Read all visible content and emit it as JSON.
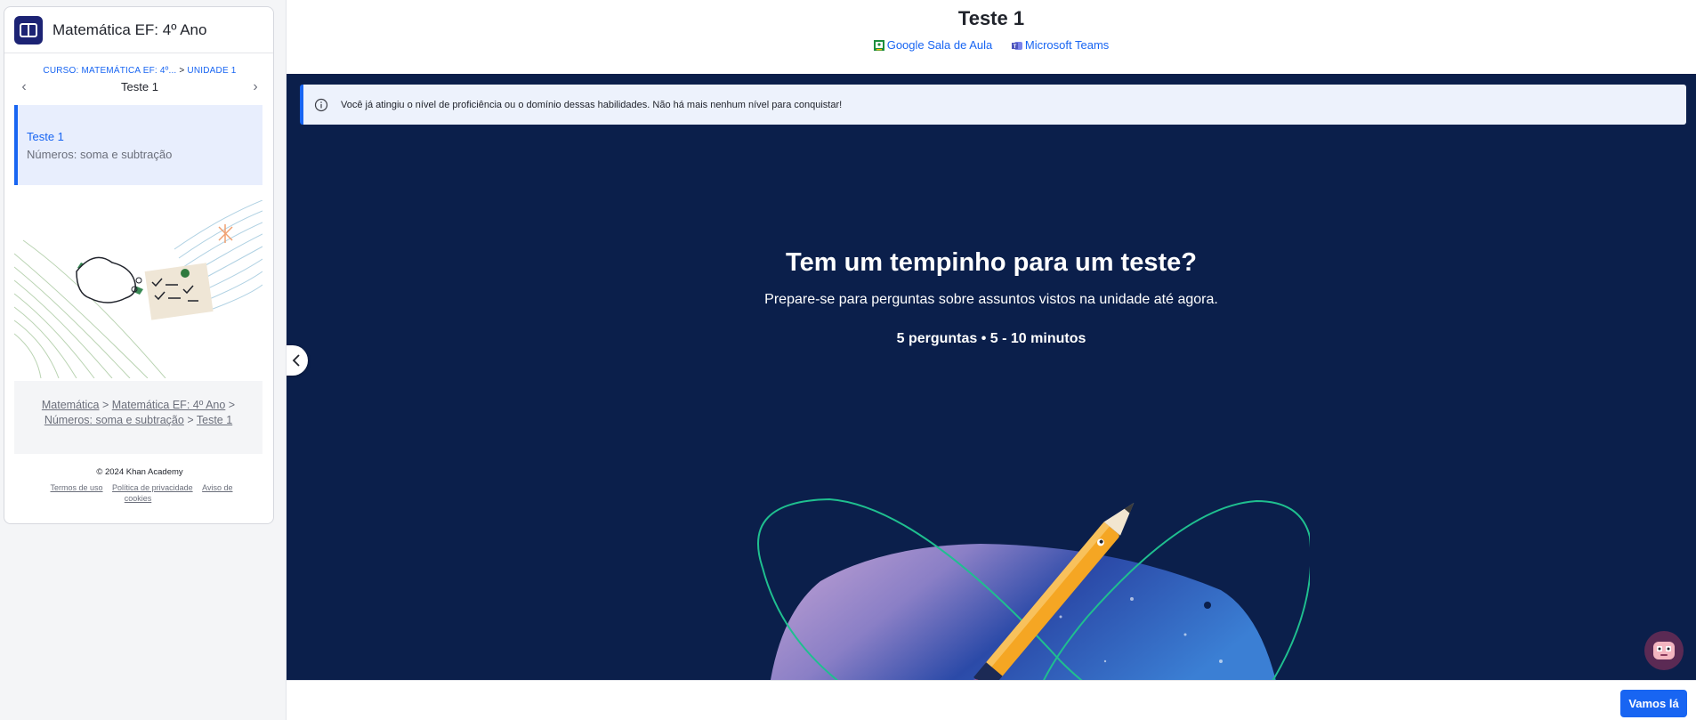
{
  "sidebar": {
    "course_title": "Matemática EF: 4º Ano",
    "breadcrumb_small": {
      "course": "CURSO: MATEMÁTICA EF: 4º...",
      "separator": ">",
      "unit": "UNIDADE 1"
    },
    "nav_title": "Teste 1",
    "active_item": {
      "title": "Teste 1",
      "subtitle": "Números: soma e subtração"
    },
    "breadcrumb": {
      "items": [
        "Matemática",
        "Matemática EF: 4º Ano",
        "Números: soma e subtração",
        "Teste 1"
      ],
      "separator": ">"
    },
    "footer": {
      "copyright": "© 2024 Khan Academy",
      "links": [
        "Termos de uso",
        "Política de privacidade",
        "Aviso de cookies"
      ]
    }
  },
  "header": {
    "title": "Teste 1",
    "share": [
      {
        "label": "Google Sala de Aula",
        "icon": "google-classroom-icon"
      },
      {
        "label": "Microsoft Teams",
        "icon": "microsoft-teams-icon"
      }
    ]
  },
  "notice": {
    "text": "Você já atingiu o nível de proficiência ou o domínio dessas habilidades. Não há mais nenhum nível para conquistar!",
    "icon": "info-icon"
  },
  "quiz": {
    "title": "Tem um tempinho para um teste?",
    "subtitle": "Prepare-se para perguntas sobre assuntos vistos na unidade até agora.",
    "meta": "5 perguntas • 5 - 10 minutos"
  },
  "actions": {
    "start_label": "Vamos lá"
  },
  "colors": {
    "accent": "#1865f2",
    "stage_bg": "#0b1f4b",
    "logo_bg": "#1c2374"
  }
}
